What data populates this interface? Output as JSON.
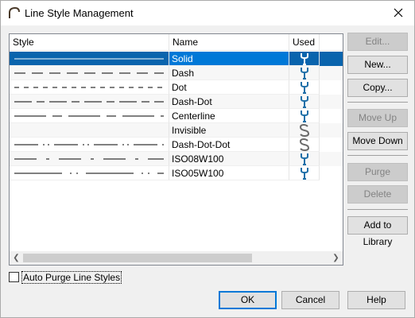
{
  "window": {
    "title": "Line Style Management",
    "icon": "arch-icon",
    "close_icon": "close-icon"
  },
  "table": {
    "columns": [
      "Style",
      "Name",
      "Used"
    ],
    "rows": [
      {
        "name": "Solid",
        "pattern": "solid",
        "used": "wrench-icon",
        "selected": true
      },
      {
        "name": "Dash",
        "pattern": "dash",
        "used": "wrench-icon"
      },
      {
        "name": "Dot",
        "pattern": "dot",
        "used": "wrench-icon"
      },
      {
        "name": "Dash-Dot",
        "pattern": "dash-dot",
        "used": "wrench-icon"
      },
      {
        "name": "Centerline",
        "pattern": "centerline",
        "used": "wrench-icon"
      },
      {
        "name": "Invisible",
        "pattern": "none",
        "used": "s-icon"
      },
      {
        "name": "Dash-Dot-Dot",
        "pattern": "dash-dot-dot",
        "used": "s-icon"
      },
      {
        "name": "ISO08W100",
        "pattern": "iso08",
        "used": "wrench-icon"
      },
      {
        "name": "ISO05W100",
        "pattern": "iso05",
        "used": "wrench-icon"
      }
    ]
  },
  "buttons": {
    "edit": "Edit...",
    "new": "New...",
    "copy": "Copy...",
    "move_up": "Move Up",
    "move_down": "Move Down",
    "purge": "Purge",
    "delete": "Delete",
    "add_to_library": "Add to Library",
    "ok": "OK",
    "cancel": "Cancel",
    "help": "Help"
  },
  "auto_purge": {
    "label": "Auto Purge Line Styles",
    "checked": false
  },
  "colors": {
    "selection": "#0078d7",
    "used_icon": "#1f6fa8",
    "s_icon": "#6b6b6b"
  }
}
